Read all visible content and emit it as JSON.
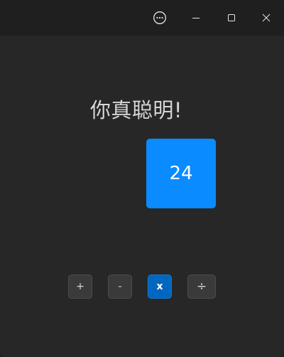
{
  "window": {
    "titlebar": {
      "buttons": [
        {
          "name": "more-options",
          "icon": "more-horizontal-circle-icon"
        },
        {
          "name": "minimize",
          "icon": "minimize-icon"
        },
        {
          "name": "maximize",
          "icon": "maximize-icon"
        },
        {
          "name": "close",
          "icon": "close-icon"
        }
      ]
    }
  },
  "main": {
    "message": "你真聪明!",
    "result_tile": {
      "value": "24",
      "color": "#0a8bff"
    },
    "operators": [
      {
        "label": "+",
        "selected": false
      },
      {
        "label": "-",
        "selected": false
      },
      {
        "label": "x",
        "selected": true
      },
      {
        "label": "÷",
        "selected": false
      }
    ]
  },
  "colors": {
    "background": "#272727",
    "titlebar": "#1f1f1f",
    "accent": "#0067c0",
    "text": "#d6d6d6"
  }
}
